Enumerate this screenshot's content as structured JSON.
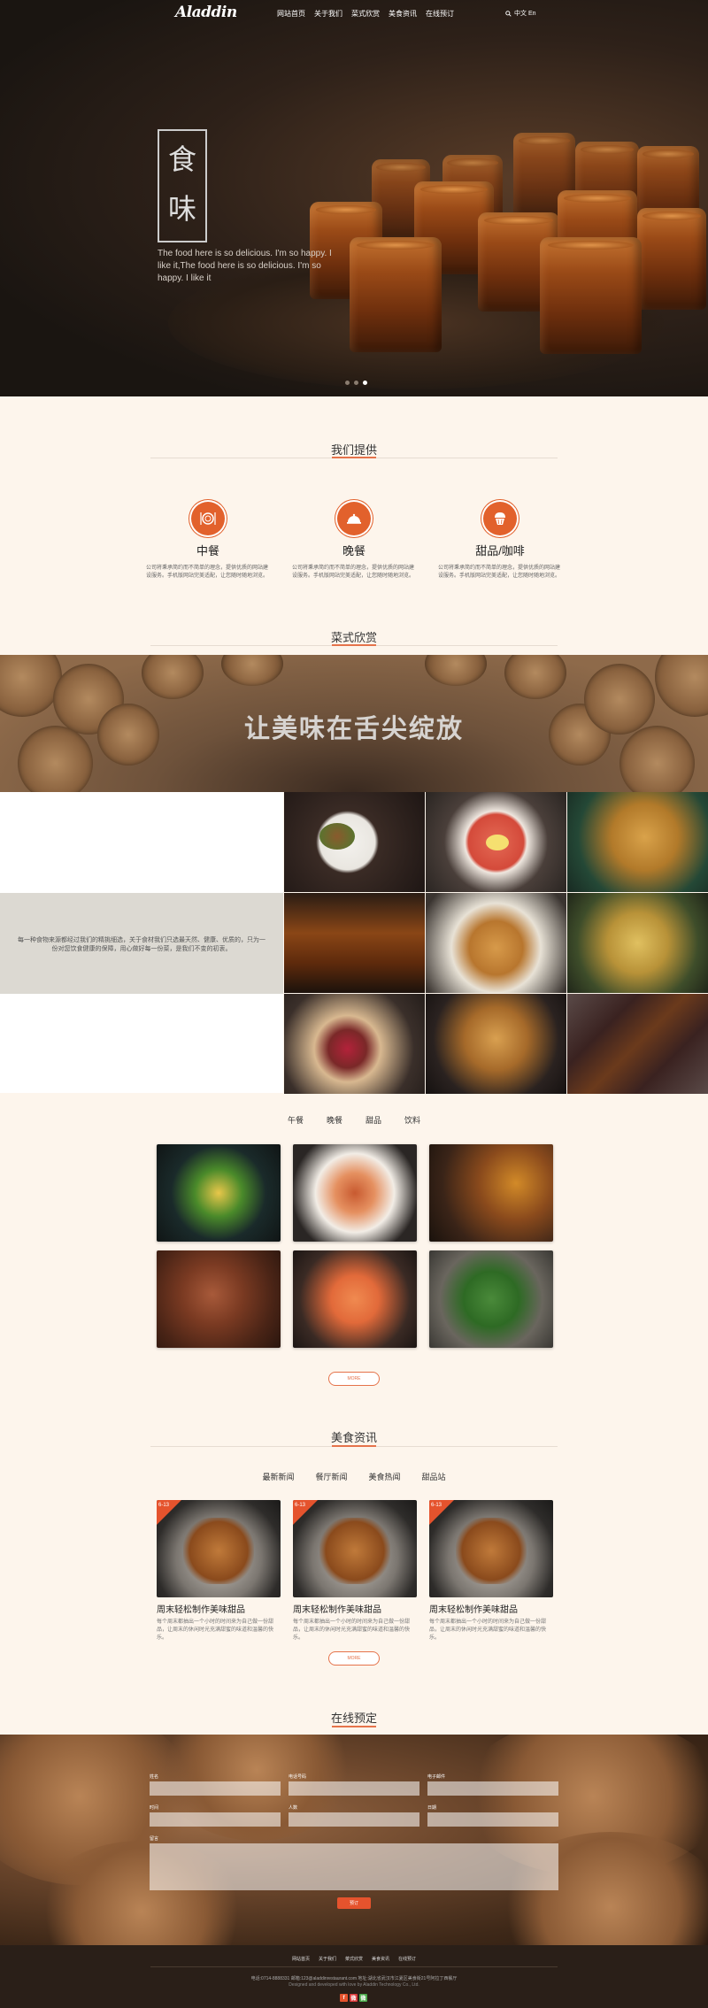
{
  "header": {
    "logo": "Aladdin",
    "nav": [
      "网站首页",
      "关于我们",
      "菜式欣赏",
      "美食资讯",
      "在线预订"
    ],
    "lang": "中文 En"
  },
  "hero": {
    "title": "食 味",
    "subtitle": "The food here is so delicious. I'm so happy. I like it,The food here is so delicious. I'm so happy. I like it"
  },
  "offer": {
    "title": "我们提供",
    "services": [
      {
        "icon": "plate-icon",
        "title": "中餐",
        "desc": "公司将秉承简约而不简单的理念，提供优质的网站建设服务。手机版网站完美适配，让您随时随地浏览。"
      },
      {
        "icon": "cloche-icon",
        "title": "晚餐",
        "desc": "公司将秉承简约而不简单的理念，提供优质的网站建设服务。手机版网站完美适配，让您随时随地浏览。"
      },
      {
        "icon": "cupcake-icon",
        "title": "甜品/咖啡",
        "desc": "公司将秉承简约而不简单的理念，提供优质的网站建设服务。手机版网站完美适配，让您随时随地浏览。"
      }
    ]
  },
  "gallery": {
    "title": "菜式欣赏",
    "banner_text": "让美味在舌尖绽放",
    "intro": "每一种食物来源都经过我们的精挑细选，关于食材我们只选最天然、健康、优质的，只为一份对您饮食健康的保障，用心做好每一份菜，是我们不变的初衷。"
  },
  "dishes": {
    "tabs": [
      "午餐",
      "晚餐",
      "甜品",
      "饮料"
    ],
    "more": "MORE"
  },
  "news": {
    "title": "美食资讯",
    "tabs": [
      "最新新闻",
      "餐厅新闻",
      "美食热闻",
      "甜品站"
    ],
    "items": [
      {
        "date": "6-13",
        "title": "周末轻松制作美味甜品",
        "desc": "每个周末都抽出一个小时的时间来为自己做一份甜品，让周末的休闲时光充满甜蜜的味道和温馨的快乐。"
      },
      {
        "date": "6-13",
        "title": "周末轻松制作美味甜品",
        "desc": "每个周末都抽出一个小时的时间来为自己做一份甜品，让周末的休闲时光充满甜蜜的味道和温馨的快乐。"
      },
      {
        "date": "6-13",
        "title": "周末轻松制作美味甜品",
        "desc": "每个周末都抽出一个小时的时间来为自己做一份甜品，让周末的休闲时光充满甜蜜的味道和温馨的快乐。"
      }
    ],
    "more": "MORE"
  },
  "booking": {
    "title": "在线预定",
    "fields": {
      "name": "姓名",
      "phone": "电话号码",
      "email": "电子邮件",
      "time": "时间",
      "people": "人数",
      "date": "日期",
      "note": "留言"
    },
    "submit": "预订"
  },
  "footer": {
    "nav": [
      "网站首页",
      "关于我们",
      "菜式欣赏",
      "美食资讯",
      "在线预订"
    ],
    "info": "电话:0714-8888331 邮箱:123@aladdinrestaurant.com 地址:湖北省武汉市江夏区美食街21号阿拉丁西餐厅",
    "credit": "Designed and developed with love by Aladdin Technology Co., Ltd.",
    "social": [
      "f",
      "微",
      "微"
    ]
  },
  "colors": {
    "accent": "#e5532d",
    "orange": "#e2612c",
    "cream": "#fdf5ec",
    "footer": "#2a1f18"
  }
}
